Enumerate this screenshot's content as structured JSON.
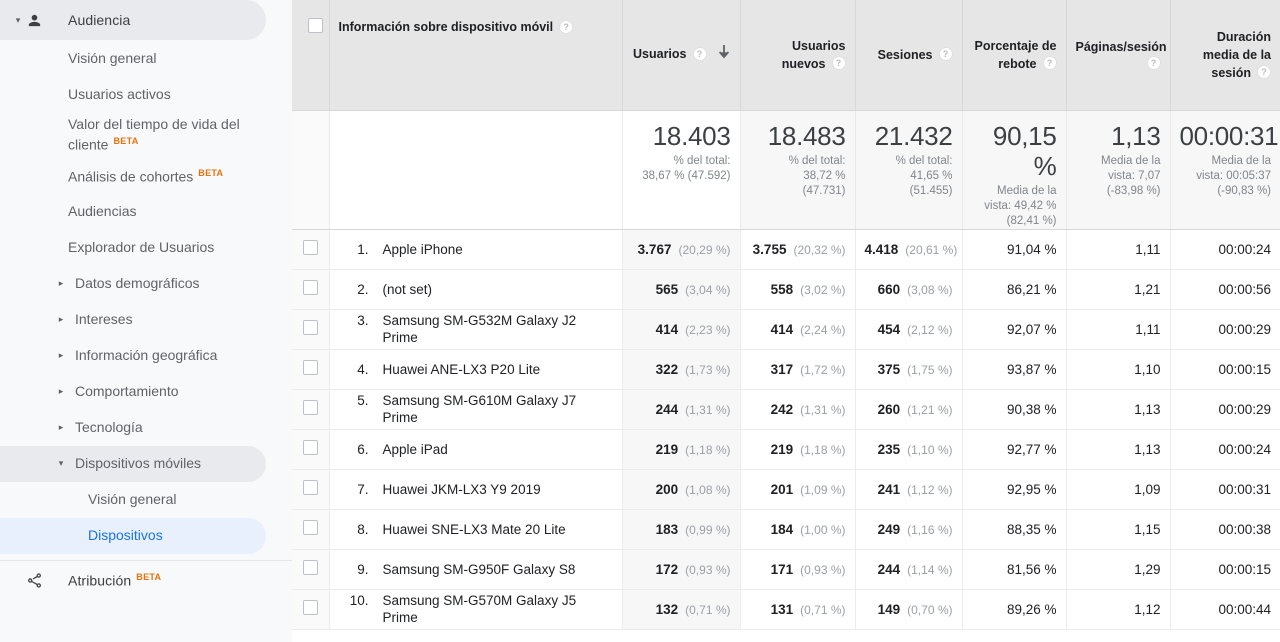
{
  "sidebar": {
    "section": {
      "label": "Audiencia",
      "icon": "person-icon",
      "caret": "▾",
      "active": true
    },
    "items": [
      {
        "label": "Visión general",
        "caret": "",
        "beta": "",
        "state": "normal",
        "indent": "none"
      },
      {
        "label": "Usuarios activos",
        "caret": "",
        "beta": "",
        "state": "normal",
        "indent": "none"
      },
      {
        "label": "Valor del tiempo de vida del cliente",
        "caret": "",
        "beta": "BETA",
        "state": "normal",
        "indent": "none"
      },
      {
        "label": "Análisis de cohortes",
        "caret": "",
        "beta": "BETA",
        "state": "normal",
        "indent": "none"
      },
      {
        "label": "Audiencias",
        "caret": "",
        "beta": "",
        "state": "normal",
        "indent": "none"
      },
      {
        "label": "Explorador de Usuarios",
        "caret": "",
        "beta": "",
        "state": "normal",
        "indent": "none"
      },
      {
        "label": "Datos demográficos",
        "caret": "▸",
        "beta": "",
        "state": "normal",
        "indent": "caret"
      },
      {
        "label": "Intereses",
        "caret": "▸",
        "beta": "",
        "state": "normal",
        "indent": "caret"
      },
      {
        "label": "Información geográfica",
        "caret": "▸",
        "beta": "",
        "state": "normal",
        "indent": "caret"
      },
      {
        "label": "Comportamiento",
        "caret": "▸",
        "beta": "",
        "state": "normal",
        "indent": "caret"
      },
      {
        "label": "Tecnología",
        "caret": "▸",
        "beta": "",
        "state": "normal",
        "indent": "caret"
      },
      {
        "label": "Dispositivos móviles",
        "caret": "▾",
        "beta": "",
        "state": "expanded",
        "indent": "caret"
      },
      {
        "label": "Visión general",
        "caret": "",
        "beta": "",
        "state": "normal",
        "indent": "sub"
      },
      {
        "label": "Dispositivos",
        "caret": "",
        "beta": "",
        "state": "selected",
        "indent": "sub"
      }
    ],
    "footer_section": {
      "label": "Atribución",
      "beta": "BETA",
      "icon": "attribution-flow-icon"
    }
  },
  "table": {
    "select_all_checkbox": "checkbox",
    "sort_indicator": "arrow-down",
    "help_glyph": "?",
    "columns": [
      {
        "key": "dimension",
        "label": "Información sobre dispositivo móvil",
        "help": true,
        "align": "left"
      },
      {
        "key": "users",
        "label": "Usuarios",
        "help": true,
        "align": "right",
        "sorted": true
      },
      {
        "key": "new_users",
        "label": "Usuarios nuevos",
        "help": true,
        "align": "right"
      },
      {
        "key": "sessions",
        "label": "Sesiones",
        "help": true,
        "align": "right"
      },
      {
        "key": "bounce_rate",
        "label": "Porcentaje de rebote",
        "help": true,
        "align": "right"
      },
      {
        "key": "pages_session",
        "label": "Páginas/sesión",
        "help": true,
        "align": "right"
      },
      {
        "key": "avg_duration",
        "label": "Duración media de la sesión",
        "help": true,
        "align": "right"
      }
    ],
    "summary": {
      "users": {
        "big": "18.403",
        "line1": "% del total:",
        "line2": "38,67 % (47.592)"
      },
      "new_users": {
        "big": "18.483",
        "line1": "% del total:",
        "line2": "38,72 %",
        "line3": "(47.731)"
      },
      "sessions": {
        "big": "21.432",
        "line1": "% del total:",
        "line2": "41,65 %",
        "line3": "(51.455)"
      },
      "bounce_rate": {
        "big": "90,15 %",
        "line1": "Media de la",
        "line2": "vista: 49,42 %",
        "line3": "(82,41 %)"
      },
      "pages_session": {
        "big": "1,13",
        "line1": "Media de la",
        "line2": "vista: 7,07",
        "line3": "(-83,98 %)"
      },
      "avg_duration": {
        "big": "00:00:31",
        "line1": "Media de la",
        "line2": "vista: 00:05:37",
        "line3": "(-90,83 %)"
      }
    },
    "rows": [
      {
        "index": "1.",
        "name": "Apple iPhone",
        "users": "3.767",
        "users_pct": "(20,29 %)",
        "new_users": "3.755",
        "new_users_pct": "(20,32 %)",
        "sessions": "4.418",
        "sessions_pct": "(20,61 %)",
        "bounce_rate": "91,04 %",
        "pages_session": "1,11",
        "avg_duration": "00:00:24"
      },
      {
        "index": "2.",
        "name": "(not set)",
        "users": "565",
        "users_pct": "(3,04 %)",
        "new_users": "558",
        "new_users_pct": "(3,02 %)",
        "sessions": "660",
        "sessions_pct": "(3,08 %)",
        "bounce_rate": "86,21 %",
        "pages_session": "1,21",
        "avg_duration": "00:00:56"
      },
      {
        "index": "3.",
        "name": "Samsung SM-G532M Galaxy J2 Prime",
        "users": "414",
        "users_pct": "(2,23 %)",
        "new_users": "414",
        "new_users_pct": "(2,24 %)",
        "sessions": "454",
        "sessions_pct": "(2,12 %)",
        "bounce_rate": "92,07 %",
        "pages_session": "1,11",
        "avg_duration": "00:00:29"
      },
      {
        "index": "4.",
        "name": "Huawei ANE-LX3 P20 Lite",
        "users": "322",
        "users_pct": "(1,73 %)",
        "new_users": "317",
        "new_users_pct": "(1,72 %)",
        "sessions": "375",
        "sessions_pct": "(1,75 %)",
        "bounce_rate": "93,87 %",
        "pages_session": "1,10",
        "avg_duration": "00:00:15"
      },
      {
        "index": "5.",
        "name": "Samsung SM-G610M Galaxy J7 Prime",
        "users": "244",
        "users_pct": "(1,31 %)",
        "new_users": "242",
        "new_users_pct": "(1,31 %)",
        "sessions": "260",
        "sessions_pct": "(1,21 %)",
        "bounce_rate": "90,38 %",
        "pages_session": "1,13",
        "avg_duration": "00:00:29"
      },
      {
        "index": "6.",
        "name": "Apple iPad",
        "users": "219",
        "users_pct": "(1,18 %)",
        "new_users": "219",
        "new_users_pct": "(1,18 %)",
        "sessions": "235",
        "sessions_pct": "(1,10 %)",
        "bounce_rate": "92,77 %",
        "pages_session": "1,13",
        "avg_duration": "00:00:24"
      },
      {
        "index": "7.",
        "name": "Huawei JKM-LX3 Y9 2019",
        "users": "200",
        "users_pct": "(1,08 %)",
        "new_users": "201",
        "new_users_pct": "(1,09 %)",
        "sessions": "241",
        "sessions_pct": "(1,12 %)",
        "bounce_rate": "92,95 %",
        "pages_session": "1,09",
        "avg_duration": "00:00:31"
      },
      {
        "index": "8.",
        "name": "Huawei SNE-LX3 Mate 20 Lite",
        "users": "183",
        "users_pct": "(0,99 %)",
        "new_users": "184",
        "new_users_pct": "(1,00 %)",
        "sessions": "249",
        "sessions_pct": "(1,16 %)",
        "bounce_rate": "88,35 %",
        "pages_session": "1,15",
        "avg_duration": "00:00:38"
      },
      {
        "index": "9.",
        "name": "Samsung SM-G950F Galaxy S8",
        "users": "172",
        "users_pct": "(0,93 %)",
        "new_users": "171",
        "new_users_pct": "(0,93 %)",
        "sessions": "244",
        "sessions_pct": "(1,14 %)",
        "bounce_rate": "81,56 %",
        "pages_session": "1,29",
        "avg_duration": "00:00:15"
      },
      {
        "index": "10.",
        "name": "Samsung SM-G570M Galaxy J5 Prime",
        "users": "132",
        "users_pct": "(0,71 %)",
        "new_users": "131",
        "new_users_pct": "(0,71 %)",
        "sessions": "149",
        "sessions_pct": "(0,70 %)",
        "bounce_rate": "89,26 %",
        "pages_session": "1,12",
        "avg_duration": "00:00:44"
      }
    ]
  },
  "colors": {
    "accent_blue": "#1a73e8",
    "selected_bg": "#e8f0fe",
    "expanded_bg": "#e8eaed",
    "beta_orange": "#e8710a",
    "header_bg": "#e6e6e6",
    "sidebar_bg": "#f8f9fa"
  }
}
